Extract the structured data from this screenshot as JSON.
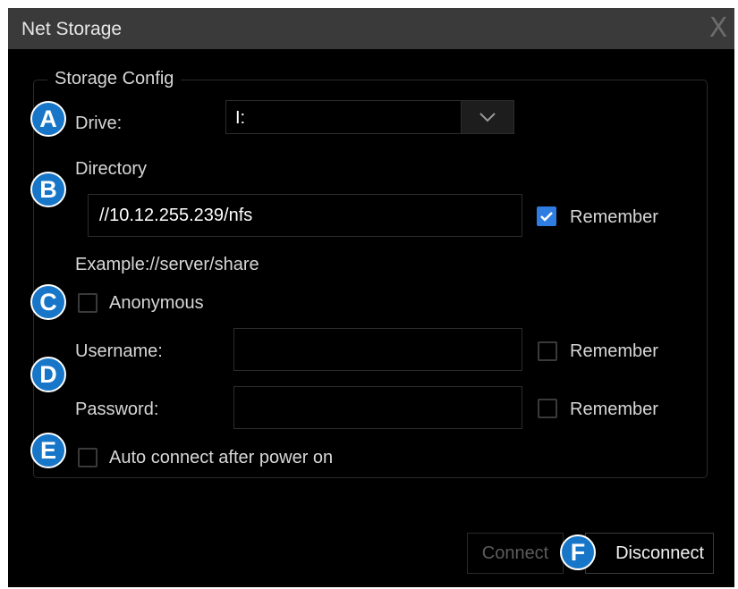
{
  "window": {
    "title": "Net Storage",
    "close_glyph": "X"
  },
  "storage_config": {
    "group_title": "Storage Config",
    "drive": {
      "label": "Drive:",
      "value": "I:"
    },
    "directory": {
      "label": "Directory",
      "value": "//10.12.255.239/nfs",
      "remember_label": "Remember",
      "remember_checked": true,
      "example": "Example://server/share"
    },
    "anonymous": {
      "label": "Anonymous",
      "checked": false
    },
    "username": {
      "label": "Username:",
      "value": "",
      "remember_label": "Remember",
      "remember_checked": false
    },
    "password": {
      "label": "Password:",
      "value": "",
      "remember_label": "Remember",
      "remember_checked": false
    },
    "auto_connect": {
      "label": "Auto connect after power on",
      "checked": false
    }
  },
  "buttons": {
    "connect": "Connect",
    "connect_enabled": false,
    "disconnect": "Disconnect"
  },
  "callouts": [
    "A",
    "B",
    "C",
    "D",
    "E",
    "F"
  ],
  "colors": {
    "accent": "#2f7de1",
    "badge": "#1776c8",
    "background": "#000000",
    "titlebar": "#3a3a3a"
  }
}
